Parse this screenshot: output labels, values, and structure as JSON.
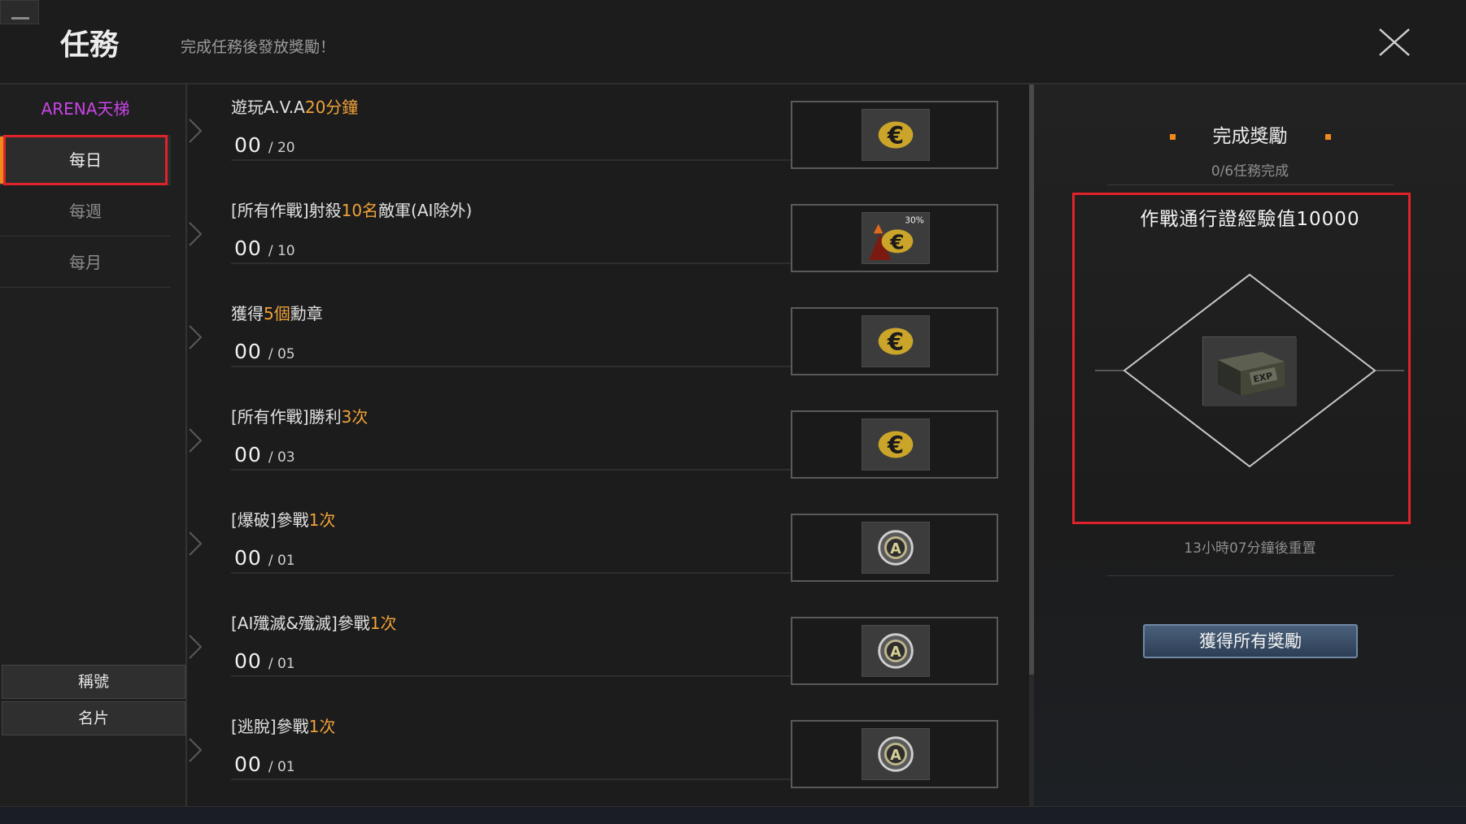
{
  "header": {
    "title": "任務",
    "subtitle": "完成任務後發放獎勵！"
  },
  "sidebar": {
    "category": "ARENA天梯",
    "tabs": [
      {
        "label": "每日",
        "active": true
      },
      {
        "label": "每週",
        "active": false
      },
      {
        "label": "每月",
        "active": false
      }
    ],
    "bottom_buttons": [
      {
        "label": "稱號"
      },
      {
        "label": "名片"
      }
    ]
  },
  "quests": [
    {
      "title_pre": "遊玩A.V.A",
      "title_hl": "20分鐘",
      "title_post": "",
      "current": "00",
      "total": "/ 20",
      "reward_icon": "euro-coin-icon"
    },
    {
      "title_pre": "[所有作戰]射殺",
      "title_hl": "10名",
      "title_post": "敵軍(AI除外)",
      "current": "00",
      "total": "/ 10",
      "reward_icon": "euro-boost-icon",
      "reward_badge": "30%"
    },
    {
      "title_pre": "獲得",
      "title_hl": "5個",
      "title_post": "勳章",
      "current": "00",
      "total": "/ 05",
      "reward_icon": "euro-coin-icon"
    },
    {
      "title_pre": "[所有作戰]勝利",
      "title_hl": "3次",
      "title_post": "",
      "current": "00",
      "total": "/ 03",
      "reward_icon": "euro-coin-icon"
    },
    {
      "title_pre": "[爆破]參戰",
      "title_hl": "1次",
      "title_post": "",
      "current": "00",
      "total": "/ 01",
      "reward_icon": "ava-medal-icon"
    },
    {
      "title_pre": "[AI殲滅&殲滅]參戰",
      "title_hl": "1次",
      "title_post": "",
      "current": "00",
      "total": "/ 01",
      "reward_icon": "ava-medal-icon"
    },
    {
      "title_pre": "[逃脫]參戰",
      "title_hl": "1次",
      "title_post": "",
      "current": "00",
      "total": "/ 01",
      "reward_icon": "ava-medal-icon"
    }
  ],
  "reward_panel": {
    "title": "完成獎勵",
    "progress": "0/6任務完成",
    "reward_name": "作戰通行證經驗值10000",
    "reward_icon": "exp-crate-icon",
    "reward_icon_label": "EXP",
    "reset_text": "13小時07分鐘後重置",
    "claim_button": "獲得所有獎勵"
  },
  "colors": {
    "highlight_text": "#f0a23a",
    "arena_label": "#c845e6",
    "active_marker": "#f08a1c",
    "annotation_box": "#e0232a",
    "claim_button": "#3a4f68"
  }
}
